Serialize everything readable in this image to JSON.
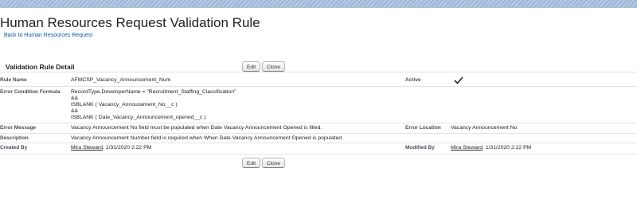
{
  "page": {
    "title": "Human Resources Request Validation Rule",
    "back_link": "Back to Human Resources Request"
  },
  "detail": {
    "section_title": "Validation Rule Detail",
    "edit_label": "Edit",
    "clone_label": "Clone",
    "rule_name_label": "Rule Name",
    "rule_name_value": "AFMCSP_Vacancy_Announcement_Num",
    "active_label": "Active",
    "active_value": true,
    "formula_label": "Error Condition Formula",
    "formula_lines": [
      "RecordType.DeveloperName = \"Recruitment_Staffing_Classification\"",
      "&&",
      "ISBLANK ( Vacancy_Annoucement_No__c )",
      "&&",
      "ISBLANK ( Date_Vacancy_Announcement_opened__c )"
    ],
    "error_message_label": "Error Message",
    "error_message_value": "Vacancy Announcement No field must be populated when Date Vacancy Announcement Opened is filled.",
    "error_location_label": "Error Location",
    "error_location_value": "Vacancy Announcement No",
    "description_label": "Description",
    "description_value": "Vacancy Announcement Number field is required when When Date Vacancy Announcement Opened is populated",
    "created_by_label": "Created By",
    "created_by_user": "Mira Steward",
    "created_by_date": ", 1/31/2020 2:22 PM",
    "modified_by_label": "Modified By",
    "modified_by_user": "Mira Steward",
    "modified_by_date": ", 1/31/2020 2:22 PM"
  }
}
